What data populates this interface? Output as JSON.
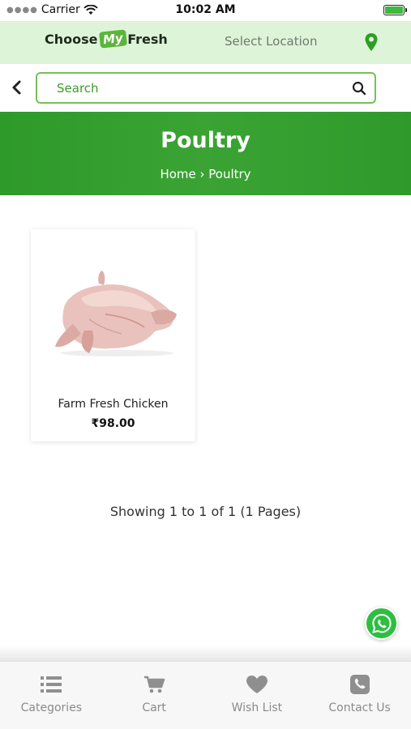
{
  "status_bar": {
    "carrier": "Carrier",
    "time": "10:02 AM"
  },
  "header": {
    "logo_part1": "Choose",
    "logo_part2": "My",
    "logo_part3": "Fresh",
    "location_label": "Select Location",
    "pin_icon": "location-pin-icon",
    "accent_color": "#3a9f2f",
    "bg_color": "#def4d8"
  },
  "search": {
    "placeholder": "Search",
    "back_icon": "chevron-left-icon",
    "search_icon": "search-icon"
  },
  "banner": {
    "title": "Poultry",
    "breadcrumb": "Home › Poultry",
    "bg_color": "#37a030"
  },
  "products": [
    {
      "name": "Farm Fresh Chicken",
      "price": "₹98.00"
    }
  ],
  "pagination": {
    "text": "Showing 1 to 1 of 1 (1 Pages)"
  },
  "whatsapp": {
    "icon": "whatsapp-icon",
    "color": "#2fbe42"
  },
  "tab_bar": {
    "tabs": [
      {
        "label": "Categories",
        "icon": "list-icon"
      },
      {
        "label": "Cart",
        "icon": "cart-icon"
      },
      {
        "label": "Wish List",
        "icon": "heart-icon"
      },
      {
        "label": "Contact Us",
        "icon": "phone-icon"
      }
    ]
  }
}
